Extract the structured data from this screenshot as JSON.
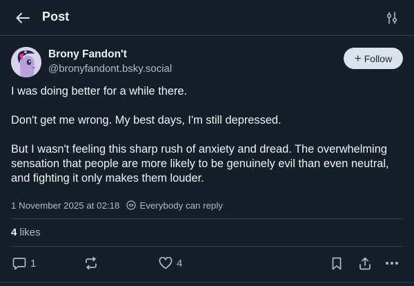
{
  "header": {
    "title": "Post",
    "back_icon": "arrow-left-icon",
    "settings_icon": "sliders-icon"
  },
  "post": {
    "author": {
      "display_name": "Brony Fandon't",
      "handle": "@bronyfandont.bsky.social"
    },
    "follow_label": "Follow",
    "paragraphs": [
      "I was doing better for a while there.",
      "Don't get me wrong. My best days, I'm still depressed.",
      "But I wasn't feeling this sharp rush of anxiety and dread. The overwhelming sensation that people are more likely to be genuinely evil than even neutral, and fighting it only makes them louder."
    ],
    "timestamp": "1 November 2025 at 02:18",
    "reply_setting": "Everybody can reply",
    "likes_count": "4",
    "likes_label": "likes"
  },
  "actions": {
    "reply_count": "1",
    "repost_count": "",
    "like_count": "4"
  },
  "colors": {
    "background": "#161e27",
    "border": "#2e4052",
    "text_primary": "#f1f3f5",
    "text_secondary": "#aebbc9",
    "follow_bg": "#dce2ea"
  }
}
